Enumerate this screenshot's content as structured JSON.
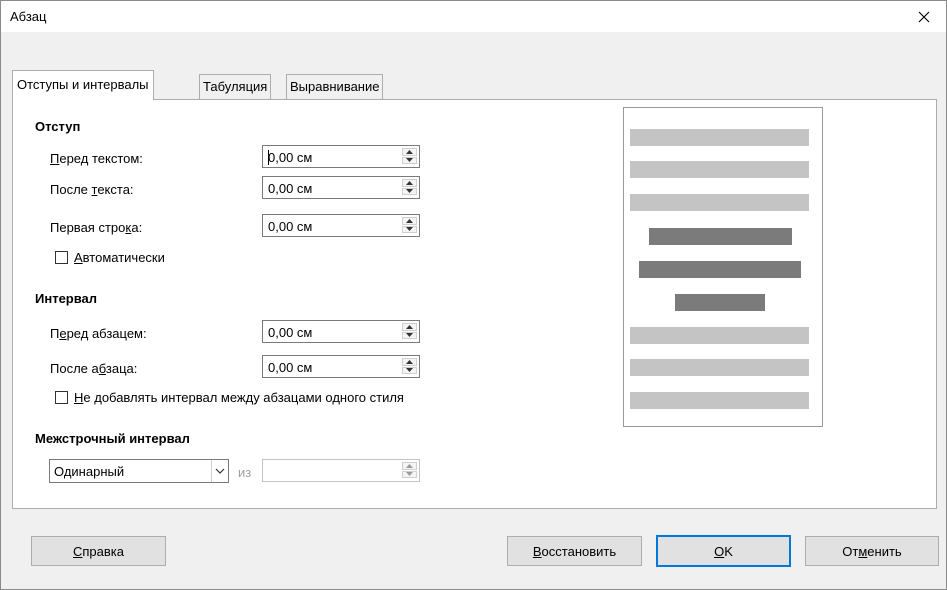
{
  "window": {
    "title": "Абзац",
    "close_icon": "close-icon"
  },
  "tabs": [
    {
      "label": "Отступы и интервалы",
      "active": true
    },
    {
      "label": "Табуляция",
      "active": false
    },
    {
      "label": "Выравнивание",
      "active": false
    }
  ],
  "indent": {
    "heading": "Отступ",
    "before_text": {
      "label_u": "П",
      "label_rest": "еред текстом:",
      "value": "0,00 см"
    },
    "after_text": {
      "label_a": "После ",
      "label_u": "т",
      "label_b": "екста:",
      "value": "0,00 см"
    },
    "first_line": {
      "label_a": "Первая стро",
      "label_u": "к",
      "label_b": "а:",
      "value": "0,00 см"
    },
    "automatic": {
      "label_u": "А",
      "label_rest": "втоматически",
      "checked": false
    }
  },
  "spacing": {
    "heading": "Интервал",
    "before_para": {
      "label_a": "П",
      "label_u": "е",
      "label_b": "ред абзацем:",
      "value": "0,00 см"
    },
    "after_para": {
      "label_a": "После а",
      "label_u": "б",
      "label_b": "заца:",
      "value": "0,00 см"
    },
    "no_space": {
      "label_u": "Н",
      "label_rest": "е добавлять интервал между абзацами одного стиля",
      "checked": false
    }
  },
  "line_spacing": {
    "heading": "Межстрочный интервал",
    "selected": "Одинарный",
    "of_label": "из",
    "of_value": ""
  },
  "buttons": {
    "help": {
      "label_u": "С",
      "label_rest": "правка"
    },
    "reset": {
      "label_u": "В",
      "label_rest": "осстановить"
    },
    "ok": {
      "label_u": "O",
      "label_rest": "K"
    },
    "cancel": {
      "label_a": "От",
      "label_u": "м",
      "label_b": "енить"
    }
  },
  "colors": {
    "accent": "#0078d7",
    "preview_light": "#c4c4c4",
    "preview_dark": "#7b7b7b"
  }
}
